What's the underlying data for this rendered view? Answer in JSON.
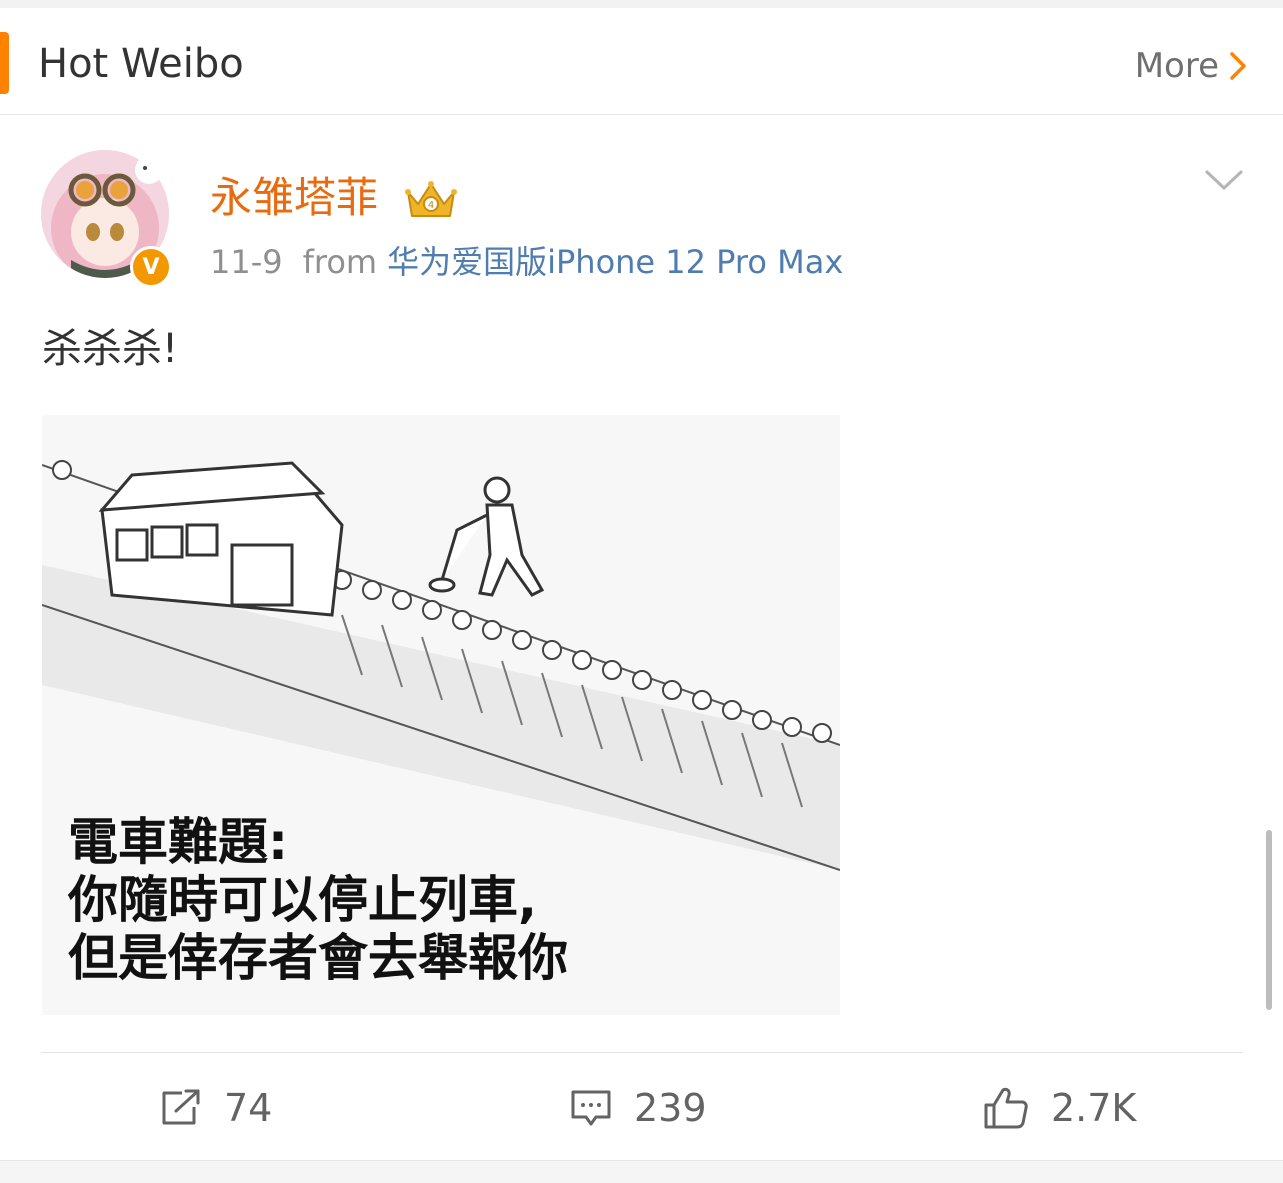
{
  "header": {
    "title": "Hot Weibo",
    "more_label": "More"
  },
  "post": {
    "author": "永雏塔菲",
    "verified_badge": "V",
    "date": "11-9",
    "from_label": "from",
    "source": "华为爱国版iPhone 12 Pro Max",
    "text": "杀杀杀!",
    "image_caption": "電車難題:\n你隨時可以停止列車,\n但是倖存者會去舉報你"
  },
  "actions": {
    "repost_count": "74",
    "comment_count": "239",
    "like_count": "2.7K"
  },
  "colors": {
    "accent": "#ff8200",
    "username": "#e86b0f",
    "link": "#507daf",
    "badge": "#f39800"
  },
  "icons": [
    "chevron-right-icon",
    "crown-icon",
    "chevron-down-icon",
    "repost-icon",
    "comment-icon",
    "like-icon"
  ]
}
